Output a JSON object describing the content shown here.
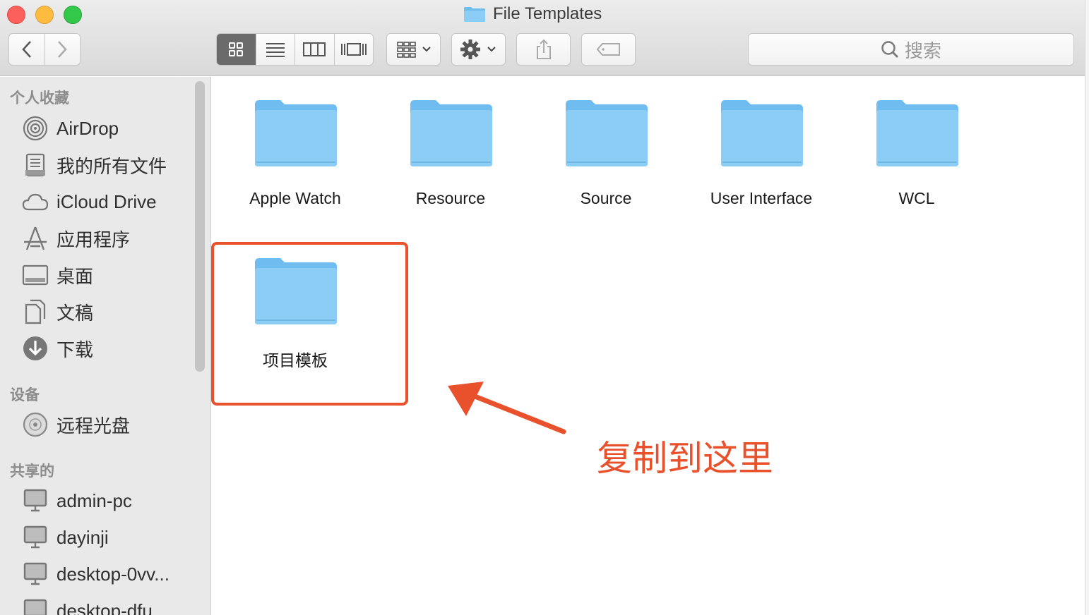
{
  "window": {
    "title": "File Templates",
    "search_placeholder": "搜索"
  },
  "sidebar": {
    "favorites_header": "个人收藏",
    "favorites": [
      {
        "label": "AirDrop",
        "icon": "airdrop-icon"
      },
      {
        "label": "我的所有文件",
        "icon": "all-files-icon"
      },
      {
        "label": "iCloud Drive",
        "icon": "cloud-icon"
      },
      {
        "label": "应用程序",
        "icon": "applications-icon"
      },
      {
        "label": "桌面",
        "icon": "desktop-icon"
      },
      {
        "label": "文稿",
        "icon": "documents-icon"
      },
      {
        "label": "下载",
        "icon": "downloads-icon"
      }
    ],
    "devices_header": "设备",
    "devices": [
      {
        "label": "远程光盘",
        "icon": "disc-icon"
      }
    ],
    "shared_header": "共享的",
    "shared": [
      {
        "label": "admin-pc",
        "icon": "computer-icon"
      },
      {
        "label": "dayinji",
        "icon": "computer-icon"
      },
      {
        "label": "desktop-0vv...",
        "icon": "computer-icon"
      },
      {
        "label": "desktop-dfu...",
        "icon": "computer-icon"
      }
    ]
  },
  "folders": [
    {
      "name": "Apple Watch"
    },
    {
      "name": "Resource"
    },
    {
      "name": "Source"
    },
    {
      "name": "User Interface"
    },
    {
      "name": "WCL"
    },
    {
      "name": "项目模板"
    }
  ],
  "annotation": {
    "text": "复制到这里",
    "color": "#e8512b"
  },
  "colors": {
    "folder": "#8ccdf6",
    "sidebar_bg": "#e9e9ea",
    "toolbar_bg": "#dcdcdc"
  }
}
